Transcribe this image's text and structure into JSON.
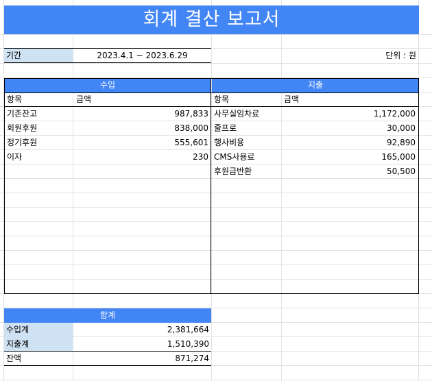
{
  "title": "회계 결산 보고서",
  "period": {
    "label": "기간",
    "value": "2023.4.1 ~ 2023.6.29"
  },
  "unit": "단위 : 원",
  "income": {
    "header": "수입",
    "col_item": "항목",
    "col_amount": "금액",
    "rows": [
      {
        "item": "기존잔고",
        "amount": "987,833"
      },
      {
        "item": "회원후원",
        "amount": "838,000"
      },
      {
        "item": "정기후원",
        "amount": "555,601"
      },
      {
        "item": "이자",
        "amount": "230"
      }
    ]
  },
  "expense": {
    "header": "지출",
    "col_item": "항목",
    "col_amount": "금액",
    "rows": [
      {
        "item": "사무실임차료",
        "amount": "1,172,000"
      },
      {
        "item": "줄프로",
        "amount": "30,000"
      },
      {
        "item": "행사비용",
        "amount": "92,890"
      },
      {
        "item": "CMS사용료",
        "amount": "165,000"
      },
      {
        "item": "후원금반환",
        "amount": "50,500"
      }
    ]
  },
  "total": {
    "header": "합계",
    "rows": [
      {
        "label": "수입계",
        "value": "2,381,664"
      },
      {
        "label": "지출계",
        "value": "1,510,390"
      },
      {
        "label": "잔액",
        "value": "871,274"
      }
    ]
  },
  "colors": {
    "header_blue": "#4285f4",
    "label_blue": "#cfe2f3"
  }
}
